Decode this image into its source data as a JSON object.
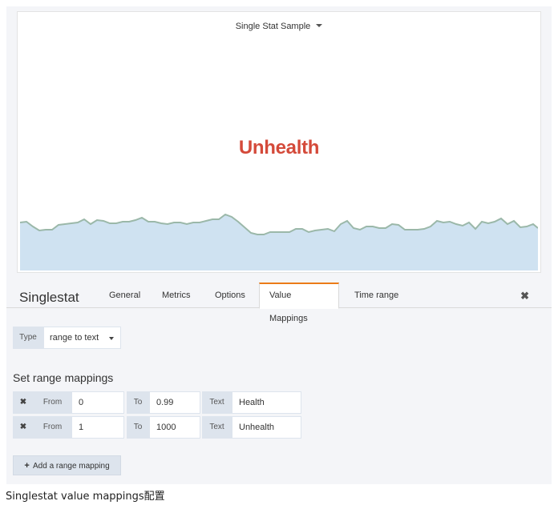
{
  "panel": {
    "title": "Single Stat Sample",
    "value": "Unhealth",
    "value_color": "#d44a3a",
    "sparkline_fill": "#cfe2f1",
    "sparkline_stroke": "#9bb8a9"
  },
  "editor": {
    "title": "Singlestat",
    "tabs": [
      {
        "label": "General"
      },
      {
        "label": "Metrics"
      },
      {
        "label": "Options"
      },
      {
        "label": "Value Mappings"
      },
      {
        "label": "Time range"
      }
    ],
    "active_tab": "Value Mappings",
    "active_tab_color": "#eb7b18",
    "close_glyph": "✖"
  },
  "type_field": {
    "label": "Type",
    "value": "range to text"
  },
  "range_mappings": {
    "title": "Set range mappings",
    "remove_glyph": "✖",
    "from_label": "From",
    "to_label": "To",
    "text_label": "Text",
    "rows": [
      {
        "from": "0",
        "to": "0.99",
        "text": "Health"
      },
      {
        "from": "1",
        "to": "1000",
        "text": "Unhealth"
      }
    ],
    "add_label": "Add a range mapping",
    "add_glyph": "+"
  },
  "caption": "Singlestat value mappings配置"
}
